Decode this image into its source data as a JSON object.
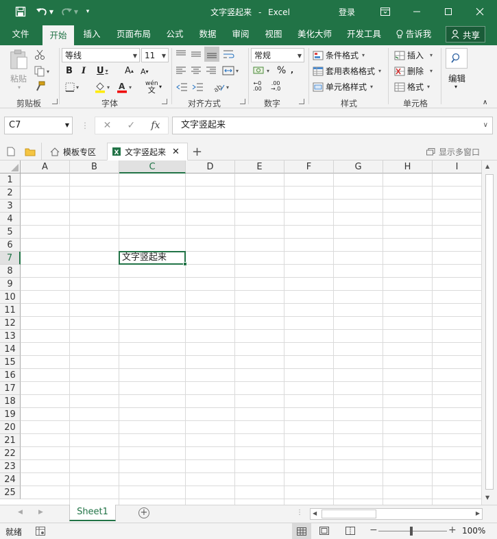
{
  "app": {
    "doc_title": "文字竖起来",
    "separator": "-",
    "app_name": "Excel",
    "login_label": "登录"
  },
  "tabs": [
    "文件",
    "开始",
    "插入",
    "页面布局",
    "公式",
    "数据",
    "审阅",
    "视图",
    "美化大师",
    "开发工具"
  ],
  "tell_me": "告诉我",
  "share_label": "共享",
  "ribbon": {
    "clipboard": {
      "paste_label": "粘贴",
      "group_label": "剪贴板"
    },
    "font": {
      "name": "等线",
      "size": "11",
      "group_label": "字体",
      "bold": "B",
      "italic": "I",
      "underline": "U"
    },
    "alignment": {
      "group_label": "对齐方式"
    },
    "number": {
      "format": "常规",
      "group_label": "数字",
      "percent": "%"
    },
    "styles": {
      "conditional": "条件格式",
      "table": "套用表格格式",
      "cell": "单元格样式",
      "group_label": "样式"
    },
    "cells": {
      "insert": "插入",
      "delete": "删除",
      "format": "格式",
      "group_label": "单元格"
    },
    "editing": {
      "label": "编辑"
    }
  },
  "formula_bar": {
    "name_box": "C7",
    "fx": "fx",
    "content": "文字竖起来"
  },
  "doc_tabs": {
    "template": "模板专区",
    "current": "文字竖起来",
    "show_multi": "显示多窗口"
  },
  "columns": [
    "A",
    "B",
    "C",
    "D",
    "E",
    "F",
    "G",
    "H",
    "I"
  ],
  "selected_column": "C",
  "rows": [
    "1",
    "2",
    "3",
    "4",
    "5",
    "6",
    "7",
    "8",
    "9",
    "10",
    "11",
    "12",
    "13",
    "14",
    "15",
    "16",
    "17",
    "18",
    "19",
    "20",
    "21",
    "22",
    "23",
    "24",
    "25"
  ],
  "selected_row": "7",
  "cells": {
    "C7": "文字竖起来"
  },
  "sheets": [
    "Sheet1"
  ],
  "status": {
    "mode": "就绪",
    "zoom": "100%"
  },
  "colors": {
    "accent": "#217346",
    "ribbon_bg": "#f3f3f3",
    "grid_line": "#dadada"
  }
}
